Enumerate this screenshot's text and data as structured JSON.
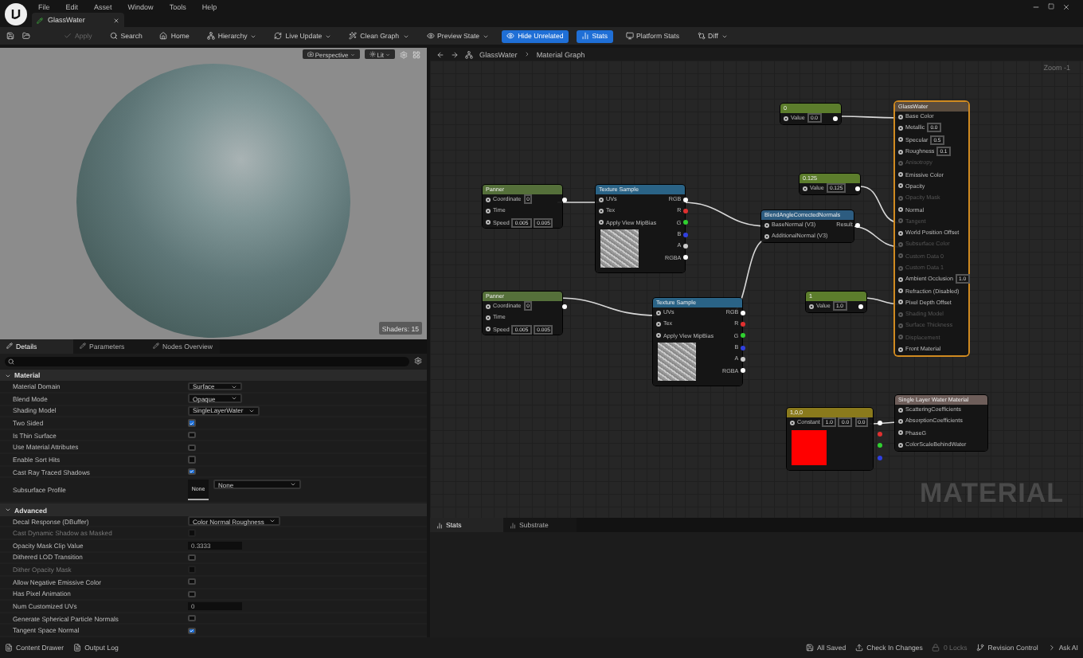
{
  "menu": [
    "File",
    "Edit",
    "Asset",
    "Window",
    "Tools",
    "Help"
  ],
  "document_tab": {
    "label": "GlassWater"
  },
  "toolbar": [
    {
      "label": "Apply",
      "dropdown": false,
      "active": false,
      "disabled": true
    },
    {
      "label": "Search",
      "dropdown": false,
      "active": false,
      "disabled": false
    },
    {
      "label": "Home",
      "dropdown": false,
      "active": false,
      "disabled": false
    },
    {
      "label": "Hierarchy",
      "dropdown": true,
      "active": false,
      "disabled": false
    },
    {
      "label": "Live Update",
      "dropdown": true,
      "active": false,
      "disabled": false
    },
    {
      "label": "Clean Graph",
      "dropdown": true,
      "active": false,
      "disabled": false
    },
    {
      "label": "Preview State",
      "dropdown": true,
      "active": false,
      "disabled": false
    },
    {
      "label": "Hide Unrelated",
      "dropdown": false,
      "active": true,
      "disabled": false
    },
    {
      "label": "Stats",
      "dropdown": false,
      "active": true,
      "disabled": false
    },
    {
      "label": "Platform Stats",
      "dropdown": false,
      "active": false,
      "disabled": false
    },
    {
      "label": "Diff",
      "dropdown": true,
      "active": false,
      "disabled": false
    }
  ],
  "viewport": {
    "view_mode": "Perspective",
    "lighting": "Lit",
    "shader_count": "Shaders: 15"
  },
  "details": {
    "tabs": [
      {
        "label": "Details",
        "selected": true
      },
      {
        "label": "Parameters",
        "selected": false
      },
      {
        "label": "Nodes Overview",
        "selected": false
      }
    ],
    "sections": [
      {
        "title": "Material",
        "rows": [
          {
            "label": "Material Domain",
            "kind": "dropdown",
            "value": "Surface"
          },
          {
            "label": "Blend Mode",
            "kind": "dropdown",
            "value": "Opaque"
          },
          {
            "label": "Shading Model",
            "kind": "dropdown",
            "value": "SingleLayerWater"
          },
          {
            "label": "Two Sided",
            "kind": "checkbox",
            "checked": true,
            "disabled": false
          },
          {
            "label": "Is Thin Surface",
            "kind": "checkbox",
            "checked": false,
            "disabled": false
          },
          {
            "label": "Use Material Attributes",
            "kind": "checkbox",
            "checked": false,
            "disabled": false
          },
          {
            "label": "Enable Sort Hits",
            "kind": "checkbox",
            "checked": false,
            "disabled": false
          },
          {
            "label": "Cast Ray Traced Shadows",
            "kind": "checkbox",
            "checked": true,
            "disabled": false
          },
          {
            "label": "Subsurface Profile",
            "kind": "profile",
            "value": "None",
            "thumbnail": "None"
          }
        ]
      },
      {
        "title": "Advanced",
        "rows": [
          {
            "label": "Decal Response (DBuffer)",
            "kind": "dropdown",
            "value": "Color Normal Roughness"
          },
          {
            "label": "Cast Dynamic Shadow as Masked",
            "kind": "checkbox",
            "checked": false,
            "disabled": true
          },
          {
            "label": "Opacity Mask Clip Value",
            "kind": "number",
            "value": "0.3333"
          },
          {
            "label": "Dithered LOD Transition",
            "kind": "checkbox",
            "checked": false,
            "disabled": false
          },
          {
            "label": "Dither Opacity Mask",
            "kind": "checkbox",
            "checked": false,
            "disabled": true
          },
          {
            "label": "Allow Negative Emissive Color",
            "kind": "checkbox",
            "checked": false,
            "disabled": false
          },
          {
            "label": "Has Pixel Animation",
            "kind": "checkbox",
            "checked": false,
            "disabled": false
          },
          {
            "label": "Num Customized UVs",
            "kind": "number",
            "value": "0"
          },
          {
            "label": "Generate Spherical Particle Normals",
            "kind": "checkbox",
            "checked": false,
            "disabled": false
          },
          {
            "label": "Tangent Space Normal",
            "kind": "checkbox",
            "checked": true,
            "disabled": false
          }
        ]
      }
    ]
  },
  "breadcrumb": [
    "GlassWater",
    "Material Graph"
  ],
  "zoom": "Zoom -1",
  "graph": {
    "nodes": [
      {
        "kind": "constant",
        "title": "0",
        "inputs": [
          {
            "label": "Value",
            "values": [
              "0.0"
            ]
          }
        ],
        "outputs": [
          {
            "color": "#ffffff"
          }
        ]
      },
      {
        "kind": "output",
        "title": "GlassWater",
        "inputs": [
          {
            "label": "Base Color",
            "disabled": false
          },
          {
            "label": "Metallic",
            "values": [
              "0.0"
            ],
            "disabled": false
          },
          {
            "label": "Specular",
            "values": [
              "0.5"
            ],
            "disabled": false
          },
          {
            "label": "Roughness",
            "values": [
              "0.1"
            ],
            "disabled": false
          },
          {
            "label": "Anisotropy",
            "disabled": true
          },
          {
            "label": "Emissive Color",
            "disabled": false
          },
          {
            "label": "Opacity",
            "disabled": false
          },
          {
            "label": "Opacity Mask",
            "disabled": true
          },
          {
            "label": "Normal",
            "disabled": false
          },
          {
            "label": "Tangent",
            "disabled": true
          },
          {
            "label": "World Position Offset",
            "disabled": false
          },
          {
            "label": "Subsurface Color",
            "disabled": true
          },
          {
            "label": "Custom Data 0",
            "disabled": true
          },
          {
            "label": "Custom Data 1",
            "disabled": true
          },
          {
            "label": "Ambient Occlusion",
            "values": [
              "1.0"
            ],
            "disabled": false
          },
          {
            "label": "Refraction (Disabled)",
            "disabled": false
          },
          {
            "label": "Pixel Depth Offset",
            "disabled": false
          },
          {
            "label": "Shading Model",
            "disabled": true
          },
          {
            "label": "Surface Thickness",
            "disabled": true
          },
          {
            "label": "Displacement",
            "disabled": true
          },
          {
            "label": "Front Material",
            "disabled": false
          }
        ]
      },
      {
        "kind": "constant",
        "title": "0.125",
        "inputs": [
          {
            "label": "Value",
            "values": [
              "0.125"
            ]
          }
        ],
        "outputs": [
          {
            "color": "#ffffff"
          }
        ]
      },
      {
        "kind": "panner",
        "title": "Panner",
        "inputs": [
          {
            "label": "Coordinate",
            "values": [
              "0"
            ]
          },
          {
            "label": "Time"
          },
          {
            "label": "Speed",
            "values": [
              "0.005",
              "0.005"
            ]
          }
        ],
        "outputs": [
          {
            "color": "#ffffff"
          }
        ]
      },
      {
        "kind": "texture",
        "title": "Texture Sample",
        "inputs": [
          {
            "label": "UVs"
          },
          {
            "label": "Tex"
          },
          {
            "label": "Apply View MipBias"
          }
        ],
        "outputs": [
          {
            "label": "RGB",
            "color": "#ffffff"
          },
          {
            "label": "R",
            "color": "#e03030"
          },
          {
            "label": "G",
            "color": "#30d030"
          },
          {
            "label": "B",
            "color": "#3040e0"
          },
          {
            "label": "A",
            "color": "#cccccc"
          },
          {
            "label": "RGBA",
            "color": "#ffffff"
          }
        ]
      },
      {
        "kind": "blend",
        "title": "BlendAngleCorrectedNormals",
        "inputs": [
          {
            "label": "BaseNormal (V3)"
          },
          {
            "label": "AdditionalNormal (V3)"
          }
        ],
        "outputs": [
          {
            "label": "Result",
            "color": "#ffffff"
          }
        ]
      },
      {
        "kind": "panner",
        "title": "Panner",
        "inputs": [
          {
            "label": "Coordinate",
            "values": [
              "0"
            ]
          },
          {
            "label": "Time"
          },
          {
            "label": "Speed",
            "values": [
              "0.005",
              "0.005"
            ]
          }
        ],
        "outputs": [
          {
            "color": "#ffffff"
          }
        ]
      },
      {
        "kind": "texture",
        "title": "Texture Sample",
        "inputs": [
          {
            "label": "UVs"
          },
          {
            "label": "Tex"
          },
          {
            "label": "Apply View MipBias"
          }
        ],
        "outputs": [
          {
            "label": "RGB",
            "color": "#ffffff"
          },
          {
            "label": "R",
            "color": "#e03030"
          },
          {
            "label": "G",
            "color": "#30d030"
          },
          {
            "label": "B",
            "color": "#3040e0"
          },
          {
            "label": "A",
            "color": "#cccccc"
          },
          {
            "label": "RGBA",
            "color": "#ffffff"
          }
        ]
      },
      {
        "kind": "constant",
        "title": "1",
        "inputs": [
          {
            "label": "Value",
            "values": [
              "1.0"
            ]
          }
        ],
        "outputs": [
          {
            "color": "#ffffff"
          }
        ]
      },
      {
        "kind": "water",
        "title": "Single Layer Water Material",
        "inputs": [
          {
            "label": "ScatteringCoefficients"
          },
          {
            "label": "AbsorptionCoefficients"
          },
          {
            "label": "PhaseG"
          },
          {
            "label": "ColorScaleBehindWater"
          }
        ]
      },
      {
        "kind": "vector",
        "title": "1,0,0",
        "inputs": [
          {
            "label": "Constant",
            "values": [
              "1.0",
              "0.0",
              "0.0"
            ]
          }
        ],
        "outputs": [
          {
            "color": "#ffffff"
          },
          {
            "color": "#e03030"
          },
          {
            "color": "#30d030"
          },
          {
            "color": "#3040e0"
          }
        ]
      }
    ]
  },
  "graph_label": "MATERIAL",
  "bottom_panel": {
    "tabs": [
      {
        "label": "Stats",
        "selected": true
      },
      {
        "label": "Substrate",
        "selected": false
      }
    ]
  },
  "status_bar": {
    "left": [
      "Content Drawer",
      "Output Log"
    ],
    "right": [
      {
        "label": "All Saved",
        "disabled": false
      },
      {
        "label": "Check In Changes",
        "disabled": false
      },
      {
        "label": "0 Locks",
        "disabled": true
      },
      {
        "label": "Revision Control",
        "disabled": false
      },
      {
        "label": "Ask AI",
        "disabled": false
      }
    ]
  }
}
